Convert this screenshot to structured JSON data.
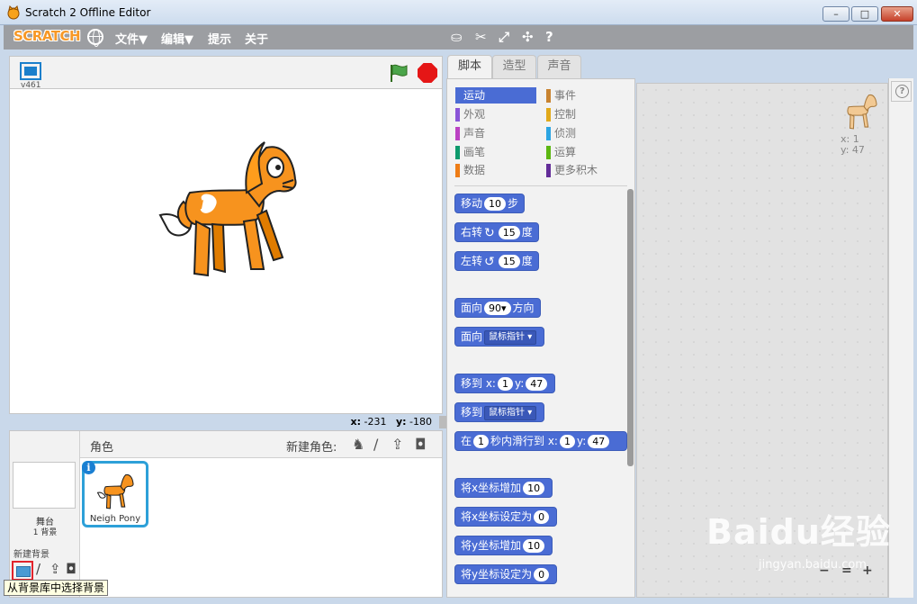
{
  "window": {
    "title": "Scratch 2 Offline Editor",
    "minimize": "–",
    "maximize": "□",
    "close": "✕"
  },
  "menubar": {
    "logo": "SCRATCH",
    "items": [
      "文件▼",
      "编辑▼",
      "提示",
      "关于"
    ],
    "tools": [
      "duplicate-icon",
      "cut-icon",
      "grow-icon",
      "shrink-icon",
      "help-icon"
    ]
  },
  "stage": {
    "version": "v461",
    "mouse_x_label": "x:",
    "mouse_x": "-231",
    "mouse_y_label": "y:",
    "mouse_y": "-180"
  },
  "sprite_pane": {
    "title": "角色",
    "new_sprite_label": "新建角色:",
    "stage_label": "舞台",
    "stage_count": "1 背景",
    "new_backdrop_label": "新建背景",
    "sprite_name": "Neigh Pony",
    "info_glyph": "i"
  },
  "tooltip": "从背景库中选择背景",
  "tabs": [
    "脚本",
    "造型",
    "声音"
  ],
  "categories": [
    {
      "label": "运动",
      "color": "#4a6cd4",
      "selected": true
    },
    {
      "label": "外观",
      "color": "#8a55d7"
    },
    {
      "label": "声音",
      "color": "#bb42c3"
    },
    {
      "label": "画笔",
      "color": "#0e9a6c"
    },
    {
      "label": "数据",
      "color": "#ee7d16"
    },
    {
      "label": "事件",
      "color": "#c88330"
    },
    {
      "label": "控制",
      "color": "#e1a91a"
    },
    {
      "label": "侦测",
      "color": "#2ca5e2"
    },
    {
      "label": "运算",
      "color": "#5cb712"
    },
    {
      "label": "更多积木",
      "color": "#632d99"
    }
  ],
  "blocks": {
    "move": {
      "a": "移动",
      "v": "10",
      "b": "步"
    },
    "turn_right": {
      "a": "右转",
      "v": "15",
      "b": "度"
    },
    "turn_left": {
      "a": "左转",
      "v": "15",
      "b": "度"
    },
    "point_dir": {
      "a": "面向",
      "v": "90▾",
      "b": "方向"
    },
    "point_towards": {
      "a": "面向",
      "dd": "鼠标指针 ▾"
    },
    "goto_xy": {
      "a": "移到 x:",
      "x": "1",
      "b": "y:",
      "y": "47"
    },
    "goto": {
      "a": "移到",
      "dd": "鼠标指针 ▾"
    },
    "glide": {
      "a": "在",
      "s": "1",
      "b": "秒内滑行到 x:",
      "x": "1",
      "c": "y:",
      "y": "47"
    },
    "change_x": {
      "a": "将x坐标增加",
      "v": "10"
    },
    "set_x": {
      "a": "将x坐标设定为",
      "v": "0"
    },
    "change_y": {
      "a": "将y坐标增加",
      "v": "10"
    },
    "set_y": {
      "a": "将y坐标设定为",
      "v": "0"
    }
  },
  "scripts_area": {
    "x_label": "x: 1",
    "y_label": "y: 47",
    "zoom_out": "−",
    "zoom_reset": "=",
    "zoom_in": "+"
  },
  "watermark": {
    "logo": "Baidu经验",
    "url": "jingyan.baidu.com"
  }
}
